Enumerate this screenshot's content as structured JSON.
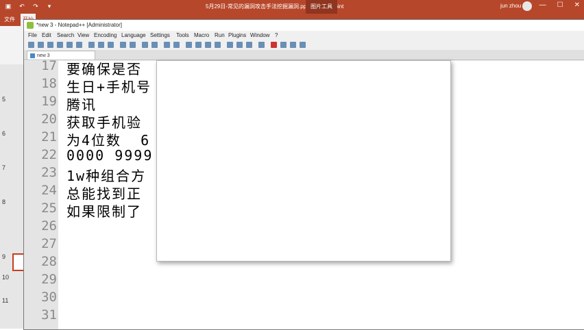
{
  "ppt": {
    "title": "5月29日-常见的漏洞攻击手法挖掘漏洞.pptx - PowerPoint",
    "tools_label": "图片工具",
    "user": "jun zhou",
    "tabs": [
      "文件",
      "开始"
    ],
    "slide_numbers": [
      "5",
      "6",
      "7",
      "8",
      "9",
      "10",
      "11"
    ]
  },
  "notepad": {
    "title": "*new 3 - Notepad++ [Administrator]",
    "menu": [
      "File",
      "Edit",
      "Search",
      "View",
      "Encoding",
      "Language",
      "Settings",
      "Tools",
      "Macro",
      "Run",
      "Plugins",
      "Window",
      "?"
    ],
    "tab_label": "new 3",
    "lines": [
      {
        "n": "17",
        "text": "要确保是否"
      },
      {
        "n": "18",
        "text": "生日+手机号"
      },
      {
        "n": "19",
        "text": "腾讯"
      },
      {
        "n": "20",
        "text": "获取手机验"
      },
      {
        "n": "21",
        "text": "为4位数  6"
      },
      {
        "n": "22",
        "text": "0000 9999"
      },
      {
        "n": "23",
        "text": "1w种组合方"
      },
      {
        "n": "24",
        "text": "总能找到正"
      },
      {
        "n": "25",
        "text": "如果限制了"
      },
      {
        "n": "26",
        "text": ""
      },
      {
        "n": "27",
        "text": ""
      },
      {
        "n": "28",
        "text": ""
      },
      {
        "n": "29",
        "text": ""
      },
      {
        "n": "30",
        "text": ""
      },
      {
        "n": "31",
        "text": ""
      }
    ]
  },
  "colors": {
    "ppt_accent": "#b7472a",
    "gutter": "#e4e4e4"
  }
}
